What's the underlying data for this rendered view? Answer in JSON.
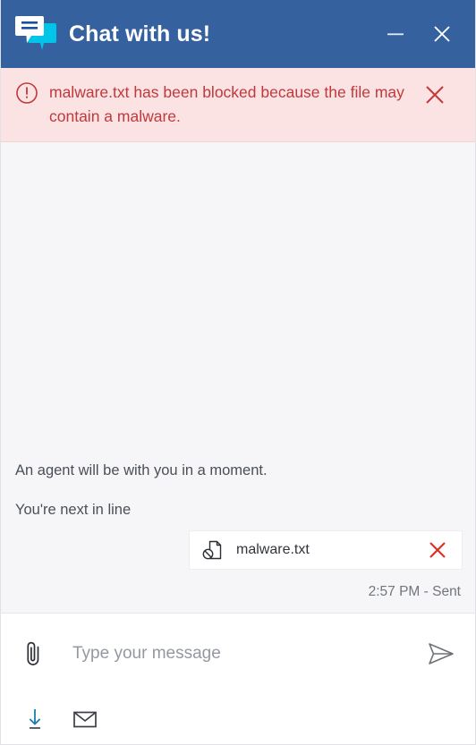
{
  "window": {
    "title": "Chat with us!",
    "logo_icon": "chat-bubbles-icon",
    "minimize_label": "—",
    "close_label": "✕",
    "header_color": "#35619F",
    "logo_bubble_front_color": "#FFFFFF",
    "logo_bubble_back_color": "#00C4E8",
    "logo_line_color": "#1F4E9C"
  },
  "alert": {
    "icon": "error-circle-icon",
    "message": "malware.txt has been blocked because the file may contain a malware.",
    "close_icon": "close-icon",
    "background_color": "#FBE2E3",
    "text_color": "#C0393C"
  },
  "conversation": {
    "messages": [
      {
        "text": "An agent will be with you in a moment."
      },
      {
        "text": "You're next in line"
      }
    ],
    "attachment": {
      "file_icon": "blocked-file-icon",
      "file_name": "malware.txt",
      "remove_icon": "close-icon",
      "remove_color": "#E02B20"
    },
    "status": "2:57 PM - Sent",
    "background_color": "#F6F6F8"
  },
  "composer": {
    "attach_icon": "paperclip-icon",
    "input_value": "",
    "input_placeholder": "Type your message",
    "send_icon": "send-paper-plane-icon"
  },
  "toolbar": {
    "buttons": [
      {
        "icon": "download-icon",
        "color": "#1C7CB0"
      },
      {
        "icon": "email-envelope-icon",
        "color": "#3A3F46"
      }
    ]
  }
}
